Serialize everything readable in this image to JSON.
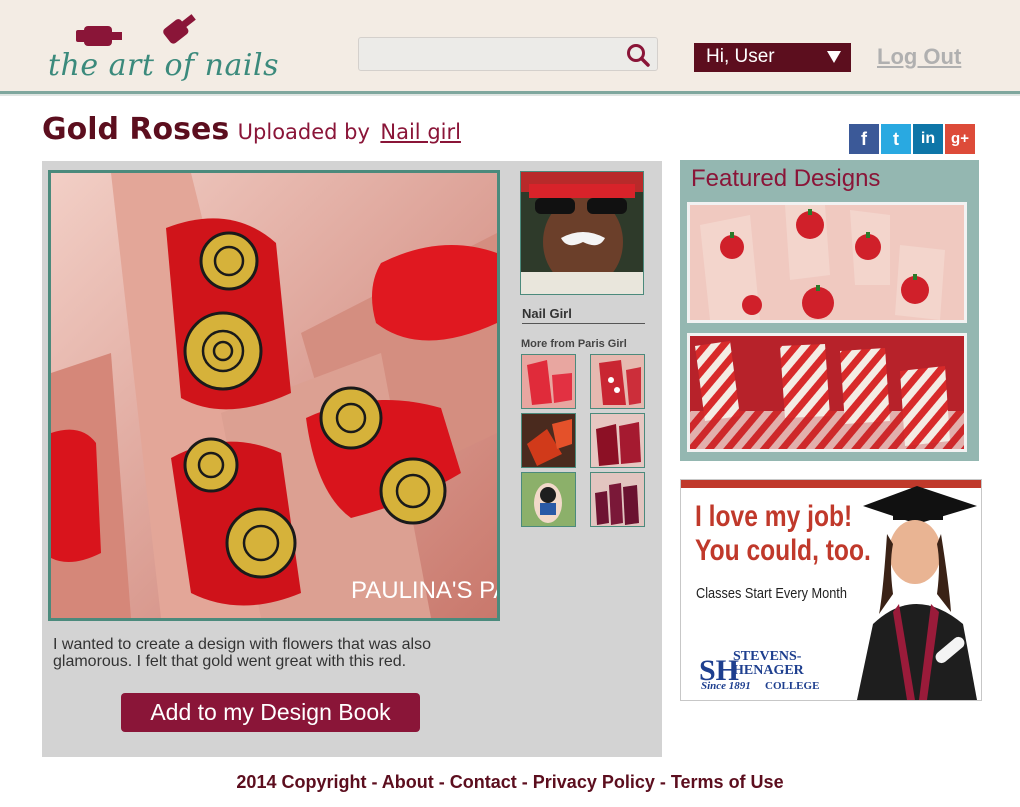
{
  "header": {
    "logo_text": "the art of nails",
    "search": {
      "value": "",
      "placeholder": ""
    },
    "user_menu_label": "Hi, User",
    "logout_label": "Log Out"
  },
  "design": {
    "title": "Gold Roses",
    "uploaded_by_prefix": "Uploaded by",
    "uploader": "Nail girl",
    "photo_watermark": "PAULINA'S PAS",
    "description": "I wanted to create a design with flowers that was also glamorous. I felt that gold went great with this red.",
    "add_button_label": "Add to my Design Book"
  },
  "social": {
    "icons": [
      "facebook-icon",
      "twitter-icon",
      "linkedin-icon",
      "google-plus-icon"
    ],
    "labels": {
      "facebook": "f",
      "twitter": "t",
      "linkedin": "in",
      "google": "g+"
    }
  },
  "profile": {
    "name": "Nail Girl",
    "more_label": "More from Paris Girl"
  },
  "featured": {
    "title": "Featured Designs"
  },
  "ad": {
    "headline_1": "I love my job!",
    "headline_2": "You could, too.",
    "subline": "Classes Start Every Month",
    "logo_line_1": "STEVENS-",
    "logo_line_2": "HENAGER",
    "logo_since": "Since 1891",
    "logo_college": "COLLEGE"
  },
  "footer": {
    "copyright": "2014 Copyright",
    "sep": " - ",
    "about": "About",
    "contact": "Contact",
    "privacy": "Privacy Policy",
    "terms": "Terms of Use"
  },
  "colors": {
    "header_bg": "#f3ece4",
    "brand_dark": "#5c0e1e",
    "brand_accent": "#8a1538",
    "teal": "#4b8a7c",
    "panel_gray": "#d3d3d3",
    "featured_bg": "#94b7b1"
  }
}
